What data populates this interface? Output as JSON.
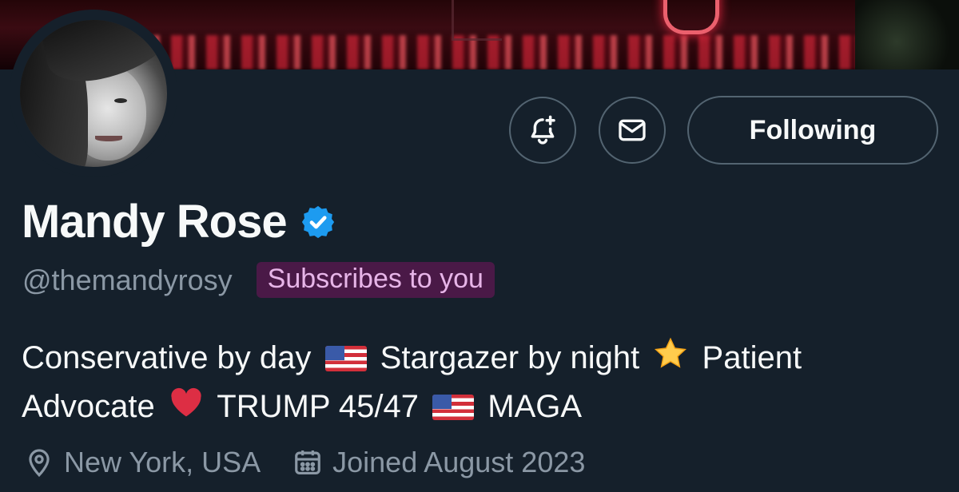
{
  "profile": {
    "name": "Mandy Rose",
    "handle": "@themandyrosy",
    "subscribes_badge": "Subscribes to you",
    "verified": true,
    "bio": {
      "part1": "Conservative by day",
      "part2": "Stargazer by night",
      "part3": "Patient Advocate",
      "part4": "TRUMP 45/47",
      "part5": "MAGA"
    },
    "location": "New York, USA",
    "joined": "Joined August 2023"
  },
  "actions": {
    "following_label": "Following",
    "notify_icon": "bell-plus-icon",
    "message_icon": "envelope-icon"
  },
  "colors": {
    "background": "#15202b",
    "verified_blue": "#1d9bf0",
    "muted_text": "#8b98a5",
    "badge_bg": "#4a1947",
    "badge_text": "#e7b5e8"
  }
}
